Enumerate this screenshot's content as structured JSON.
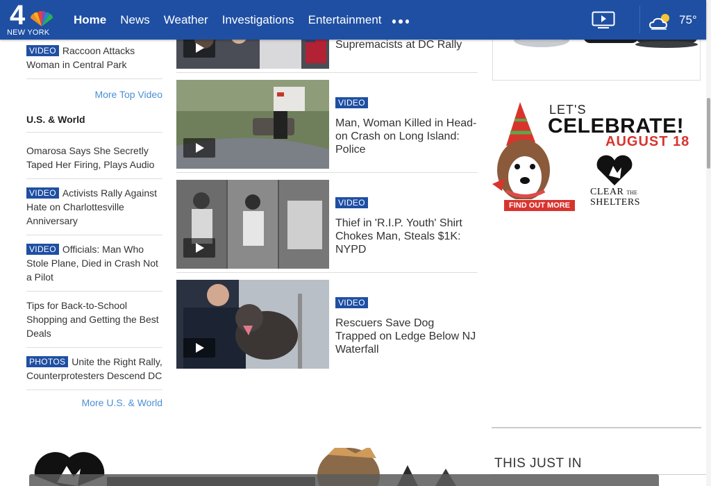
{
  "header": {
    "logo_number": "4",
    "logo_city": "NEW YORK",
    "nav": [
      "Home",
      "News",
      "Weather",
      "Investigations",
      "Entertainment"
    ],
    "temperature": "75°",
    "brand_color": "#1f4fa3"
  },
  "left": {
    "top_items": [
      {
        "badge": "VIDEO",
        "text": "Raccoon Attacks Woman in Central Park"
      }
    ],
    "more_top_video": "More Top Video",
    "section_title": "U.S. & World",
    "world_items": [
      {
        "badge": "",
        "text": "Omarosa Says She Secretly Taped Her Firing, Plays Audio"
      },
      {
        "badge": "VIDEO",
        "text": "Activists Rally Against Hate on Charlottesville Anniversary"
      },
      {
        "badge": "VIDEO",
        "text": "Officials: Man Who Stole Plane, Died in Crash Not a Pilot"
      },
      {
        "badge": "",
        "text": "Tips for Back-to-School Shopping and Getting the Best Deals"
      },
      {
        "badge": "PHOTOS",
        "text": "Unite the Right Rally, Counterprotesters Descend DC"
      }
    ],
    "more_world": "More U.S. & World"
  },
  "stories": [
    {
      "badge": "",
      "title": "Supremacists at DC Rally"
    },
    {
      "badge": "VIDEO",
      "title": "Man, Woman Killed in Head-on Crash on Long Island: Police"
    },
    {
      "badge": "VIDEO",
      "title": "Thief in 'R.I.P. Youth' Shirt Chokes Man, Steals $1K: NYPD"
    },
    {
      "badge": "VIDEO",
      "title": "Rescuers Save Dog Trapped on Ledge Below NJ Waterfall"
    }
  ],
  "ad": {
    "lets": "LET'S",
    "celebrate": "CELEBRATE!",
    "date": "AUGUST 18",
    "cta": "FIND OUT MORE",
    "brand_line1": "CLEAR",
    "brand_the": "THE",
    "brand_line2": "SHELTERS"
  },
  "this_just_in": "THIS JUST IN",
  "icons": {
    "video": "tv-play-icon",
    "weather": "partly-cloudy-icon",
    "more": "more-dots-icon"
  }
}
